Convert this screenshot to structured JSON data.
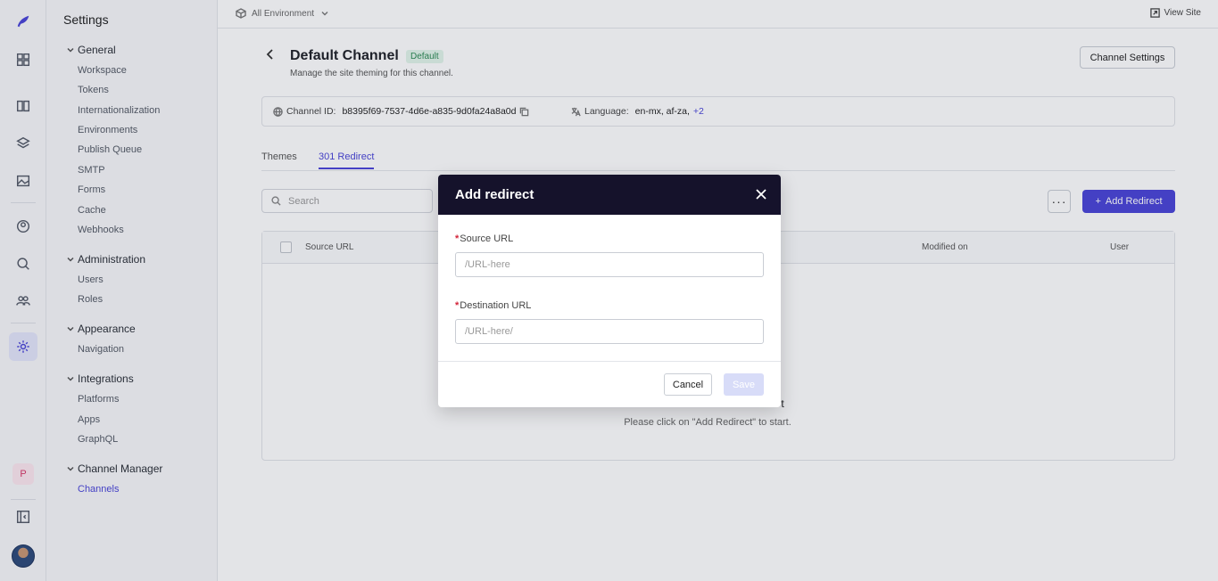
{
  "sidebar": {
    "title": "Settings",
    "groups": [
      {
        "label": "General",
        "items": [
          "Workspace",
          "Tokens",
          "Internationalization",
          "Environments",
          "Publish Queue",
          "SMTP",
          "Forms",
          "Cache",
          "Webhooks"
        ]
      },
      {
        "label": "Administration",
        "items": [
          "Users",
          "Roles"
        ]
      },
      {
        "label": "Appearance",
        "items": [
          "Navigation"
        ]
      },
      {
        "label": "Integrations",
        "items": [
          "Platforms",
          "Apps",
          "GraphQL"
        ]
      },
      {
        "label": "Channel Manager",
        "items": [
          "Channels"
        ]
      }
    ],
    "active_item": "Channels"
  },
  "rail": {
    "icons": [
      "logo-icon",
      "dashboard-icon",
      "book-icon",
      "layers-icon",
      "image-icon",
      "user-circle-icon",
      "search-analytics-icon",
      "team-icon",
      "settings-icon",
      "collapse-sidebar-icon"
    ],
    "workspace_badge": "P"
  },
  "topbar": {
    "environment": "All Environment",
    "view_site": "View Site"
  },
  "channel": {
    "title": "Default Channel",
    "badge": "Default",
    "subtitle": "Manage the site theming for this channel.",
    "settings_button": "Channel Settings",
    "id_label": "Channel ID:",
    "id_value": "b8395f69-7537-4d6e-a835-9d0fa24a8a0d",
    "language_label": "Language:",
    "language_value": "en-mx, af-za,",
    "language_more": "+2"
  },
  "tabs": [
    {
      "label": "Themes",
      "active": false
    },
    {
      "label": "301 Redirect",
      "active": true
    }
  ],
  "toolbar": {
    "search_placeholder": "Search",
    "more_label": "···",
    "add_label": "Add Redirect"
  },
  "table": {
    "columns": [
      "Source URL",
      "Modified on",
      "User"
    ],
    "empty_title": "t",
    "empty_sub": "Please click on \"Add Redirect\" to start."
  },
  "modal": {
    "title": "Add redirect",
    "source_label": "Source URL",
    "source_placeholder": "/URL-here",
    "destination_label": "Destination URL",
    "destination_placeholder": "/URL-here/",
    "required_mark": "*",
    "cancel_label": "Cancel",
    "save_label": "Save"
  },
  "colors": {
    "accent": "#4a45d8",
    "modal_header": "#15122b",
    "required": "#d3243a",
    "badge_bg": "#e2f5ea",
    "badge_fg": "#2d8a55"
  }
}
